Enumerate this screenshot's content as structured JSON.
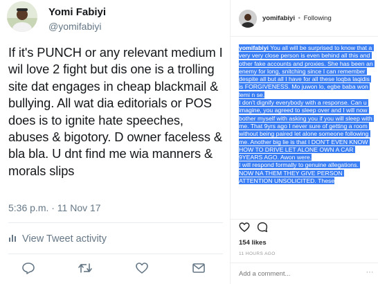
{
  "tweet": {
    "author_name": "Yomi Fabiyi",
    "handle": "@yomifabiyi",
    "text": "If it's PUNCH or any relevant medium I wil love 2 fight but dis one is a trolling site dat engages in cheap blackmail & bullying. All wat dia editorials or POS does is to ignite hate speeches, abuses & bigotory. D owner faceless & bla bla. U dnt find me wia manners & morals slips",
    "timestamp": "5:36 p.m. · 11 Nov 17",
    "activity_label": "View Tweet activity",
    "icons": {
      "reply": "reply-icon",
      "retweet": "retweet-icon",
      "like": "heart-icon",
      "dm": "envelope-icon",
      "activity": "bar-chart-icon"
    },
    "colors": {
      "text": "#14171a",
      "muted": "#657786",
      "divider": "#e6ecf0"
    }
  },
  "instagram": {
    "username": "yomifabiyi",
    "separator": "•",
    "follow_status": "Following",
    "caption_user": "yomifabiyi",
    "caption": " You all will be surprised to know that a very very close person is even behind all this and other fake accounts and proxies. She has been an enemy for long, snitching since I can remember despite all but all I have for all these loqba laqidis is FORGIVENESS. Mo juwon lo, egbe baba won lemi n se.\nI don't dignify everybody with a response. Can u imagine, you agreed to sleep over and I will now bother myself with asking you if you will sleep with me. That 9yrs ago I never sure of getting a room without being paired let alone someone following me. Another big lie is that I DON'T EVEN KNOW HOW TO DRIVE LET ALONE OWN A CAR 9YEARS AGO. Awon were.\nI will respond formally to genuine allegations. NOW NA THEM THEY GIVE PERSON ATTENTION UNSOLICITED. These",
    "likes": "154 likes",
    "time_ago": "11 HOURS AGO",
    "comment_placeholder": "Add a comment...",
    "more_label": "···",
    "icons": {
      "like": "heart-outline-icon",
      "comment": "comment-icon"
    },
    "colors": {
      "highlight": "#3a7ef5",
      "text": "#262626",
      "muted": "#999999"
    }
  }
}
